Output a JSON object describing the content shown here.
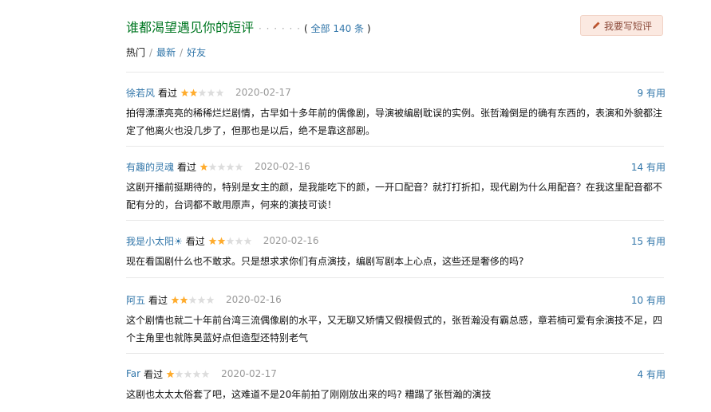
{
  "header": {
    "title": "谁都渴望遇见你的短评",
    "dots": "· · · · · ·",
    "count": "全部 140 条",
    "open_paren": "(",
    "close_paren": ")",
    "write_button": "我要写短评"
  },
  "tabs": {
    "hot": "热门",
    "sep1": "/",
    "latest": "最新",
    "sep2": "/",
    "friends": "好友"
  },
  "comments": [
    {
      "user": "徐若风",
      "status": "看过",
      "rating": 2,
      "date": "2020-02-17",
      "votes": "9 有用",
      "text": "拍得漂漂亮亮的稀稀烂烂剧情，古早如十多年前的偶像剧，导演被编剧耽误的实例。张哲瀚倒是的确有东西的，表演和外貌都注定了他离火也没几步了，但那也是以后，绝不是靠这部剧。"
    },
    {
      "user": "有趣的灵魂",
      "status": "看过",
      "rating": 1,
      "date": "2020-02-16",
      "votes": "14 有用",
      "text": "这剧开播前挺期待的，特别是女主的颜，是我能吃下的颜，一开口配音？就打打折扣，现代剧为什么用配音？在我这里配音都不配有分的，台词都不敢用原声，何来的演技可谈！"
    },
    {
      "user": "我是小太阳☀",
      "status": "看过",
      "rating": 2,
      "date": "2020-02-16",
      "votes": "15 有用",
      "text": "现在看国剧什么也不敢求。只是想求求你们有点演技，编剧写剧本上心点，这些还是奢侈的吗?"
    },
    {
      "user": "阿五",
      "status": "看过",
      "rating": 2,
      "date": "2020-02-16",
      "votes": "10 有用",
      "text": "这个剧情也就二十年前台湾三流偶像剧的水平，又无聊又矫情又假模假式的，张哲瀚没有霸总感，章若楠可爱有余演技不足，四个主角里也就陈昊蓝好点但造型还特别老气"
    },
    {
      "user": "Far",
      "status": "看过",
      "rating": 1,
      "date": "2020-02-17",
      "votes": "4 有用",
      "text": "这剧也太太太俗套了吧，这难道不是20年前拍了刚刚放出来的吗? 糟蹋了张哲瀚的演技"
    }
  ],
  "colors": {
    "star_on": "#ffac2d",
    "star_off": "#dddddd",
    "link": "#3377aa",
    "title": "#007722"
  }
}
